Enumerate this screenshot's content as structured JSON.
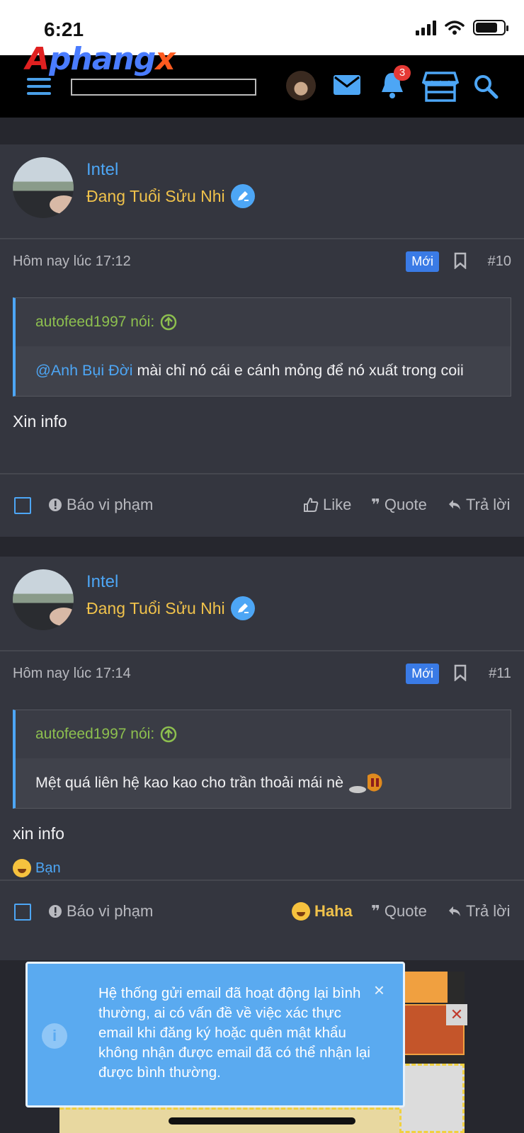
{
  "status_bar": {
    "time": "6:21"
  },
  "header": {
    "logo_a": "A",
    "logo_main": "phang",
    "logo_x": "x",
    "notification_count": "3",
    "search_placeholder": ""
  },
  "posts": [
    {
      "username": "Intel",
      "user_title": "Đang Tuổi Sửu Nhi",
      "date": "Hôm nay lúc 17:12",
      "new_label": "Mới",
      "post_number": "#10",
      "quote_author": "autofeed1997 nói:",
      "quote_mention": "@Anh Bụi Đời",
      "quote_text": " mài chỉ nó cái e cánh mỏng để nó xuất trong coii",
      "message": "Xin info",
      "actions": {
        "report": "Báo vi phạm",
        "like": "Like",
        "quote": "Quote",
        "reply": "Trả lời"
      }
    },
    {
      "username": "Intel",
      "user_title": "Đang Tuổi Sửu Nhi",
      "date": "Hôm nay lúc 17:14",
      "new_label": "Mới",
      "post_number": "#11",
      "quote_author": "autofeed1997 nói:",
      "quote_text": "Mệt quá liên hệ kao kao cho trần thoải mái nè",
      "message": "xin info",
      "reaction_user": "Bạn",
      "actions": {
        "report": "Báo vi phạm",
        "like": "Haha",
        "quote": "Quote",
        "reply": "Trả lời"
      }
    }
  ],
  "notice": {
    "text": "Hệ thống gửi email đã hoạt động lại bình thường, ai có vấn đề về việc xác thực email khi đăng ký hoặc quên mật khẩu không nhận được email đã có thể nhận lại được bình thường.",
    "close": "×"
  },
  "colors": {
    "accent": "#4da6f5",
    "title_gold": "#f0c24b",
    "quote_green": "#8dbf4f",
    "badge_red": "#e53935"
  }
}
